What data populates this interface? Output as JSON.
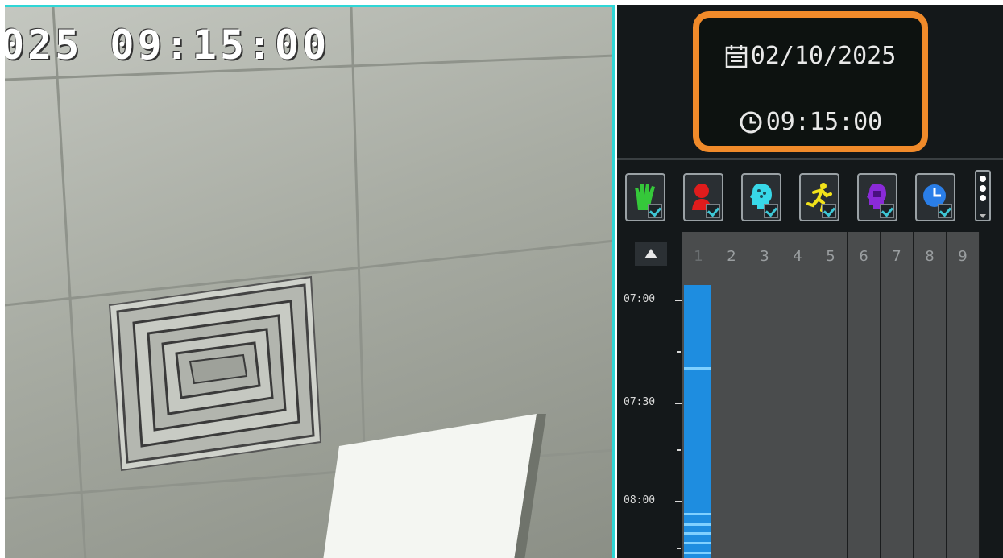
{
  "video": {
    "osd_timestamp": "025 09:15:00"
  },
  "panel": {
    "date": "02/10/2025",
    "time": "09:15:00",
    "highlight_color": "#f08a2a",
    "filters": [
      {
        "icon": "hand-motion-icon",
        "color": "#35c83a",
        "checked": true
      },
      {
        "icon": "person-red-icon",
        "color": "#e01c1c",
        "checked": true
      },
      {
        "icon": "face-head-icon",
        "color": "#38d8e8",
        "checked": true
      },
      {
        "icon": "running-person-icon",
        "color": "#f2e21a",
        "checked": true
      },
      {
        "icon": "face-purple-icon",
        "color": "#8a2ad8",
        "checked": true
      },
      {
        "icon": "clock-blue-icon",
        "color": "#2a7ee8",
        "checked": true
      }
    ],
    "channels": [
      "1",
      "2",
      "3",
      "4",
      "5",
      "6",
      "7",
      "8",
      "9"
    ],
    "time_ticks": [
      "07:00",
      "07:30",
      "08:00"
    ],
    "recording_color": "#1e8de0"
  }
}
